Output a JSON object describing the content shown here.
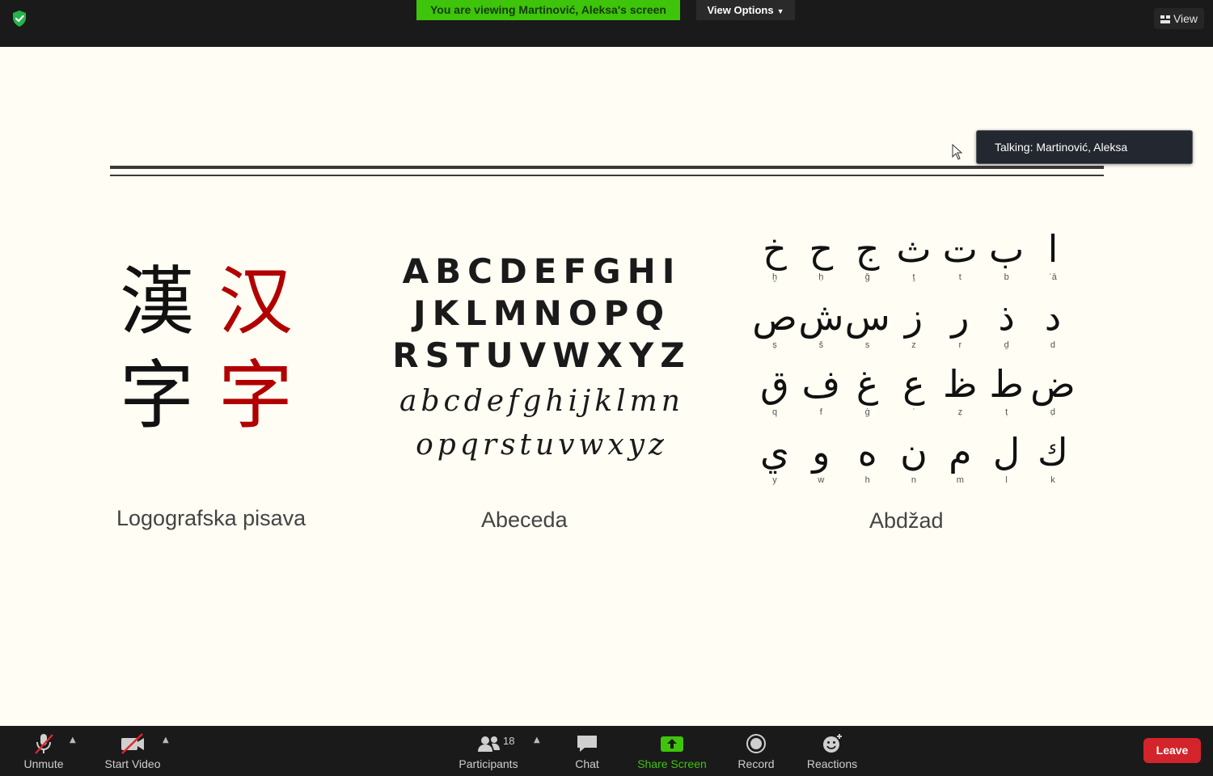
{
  "topbar": {
    "viewing_banner": "You are viewing Martinović, Aleksa's screen",
    "view_options_label": "View Options",
    "view_label": "View"
  },
  "talking_indicator": "Talking: Martinović, Aleksa",
  "slide": {
    "logographic": {
      "traditional": [
        "漢",
        "字"
      ],
      "simplified": [
        "汉",
        "字"
      ],
      "caption": "Logografska pisava"
    },
    "alphabet": {
      "caps_rows": [
        "ABCDEFGHI",
        "JKLMNOPQ",
        "RSTUVWXYZ"
      ],
      "lower_rows": [
        "abcdefghijklmn",
        "opqrstuvwxyz"
      ],
      "caption": "Abeceda"
    },
    "abjad": {
      "rows": [
        [
          {
            "l": "خ",
            "t": "ḫ"
          },
          {
            "l": "ح",
            "t": "ḥ"
          },
          {
            "l": "ج",
            "t": "ǧ"
          },
          {
            "l": "ث",
            "t": "ṯ"
          },
          {
            "l": "ت",
            "t": "t"
          },
          {
            "l": "ب",
            "t": "b"
          },
          {
            "l": "ا",
            "t": "ʾā"
          }
        ],
        [
          {
            "l": "ص",
            "t": "ṣ"
          },
          {
            "l": "ش",
            "t": "š"
          },
          {
            "l": "س",
            "t": "s"
          },
          {
            "l": "ز",
            "t": "z"
          },
          {
            "l": "ر",
            "t": "r"
          },
          {
            "l": "ذ",
            "t": "ḏ"
          },
          {
            "l": "د",
            "t": "d"
          }
        ],
        [
          {
            "l": "ق",
            "t": "q"
          },
          {
            "l": "ف",
            "t": "f"
          },
          {
            "l": "غ",
            "t": "ġ"
          },
          {
            "l": "ع",
            "t": "ʿ"
          },
          {
            "l": "ظ",
            "t": "ẓ"
          },
          {
            "l": "ط",
            "t": "ṭ"
          },
          {
            "l": "ض",
            "t": "ḍ"
          }
        ],
        [
          {
            "l": "ي",
            "t": "y"
          },
          {
            "l": "و",
            "t": "w"
          },
          {
            "l": "ه",
            "t": "h"
          },
          {
            "l": "ن",
            "t": "n"
          },
          {
            "l": "م",
            "t": "m"
          },
          {
            "l": "ل",
            "t": "l"
          },
          {
            "l": "ك",
            "t": "k"
          }
        ]
      ],
      "caption": "Abdžad"
    }
  },
  "toolbar": {
    "unmute": "Unmute",
    "start_video": "Start Video",
    "participants": "Participants",
    "participants_count": "18",
    "chat": "Chat",
    "share_screen": "Share Screen",
    "record": "Record",
    "reactions": "Reactions",
    "leave": "Leave"
  },
  "colors": {
    "banner_green": "#3ec40b",
    "hanzi_red": "#b20000",
    "leave_red": "#d3242b",
    "slide_bg": "#fffdf4"
  }
}
